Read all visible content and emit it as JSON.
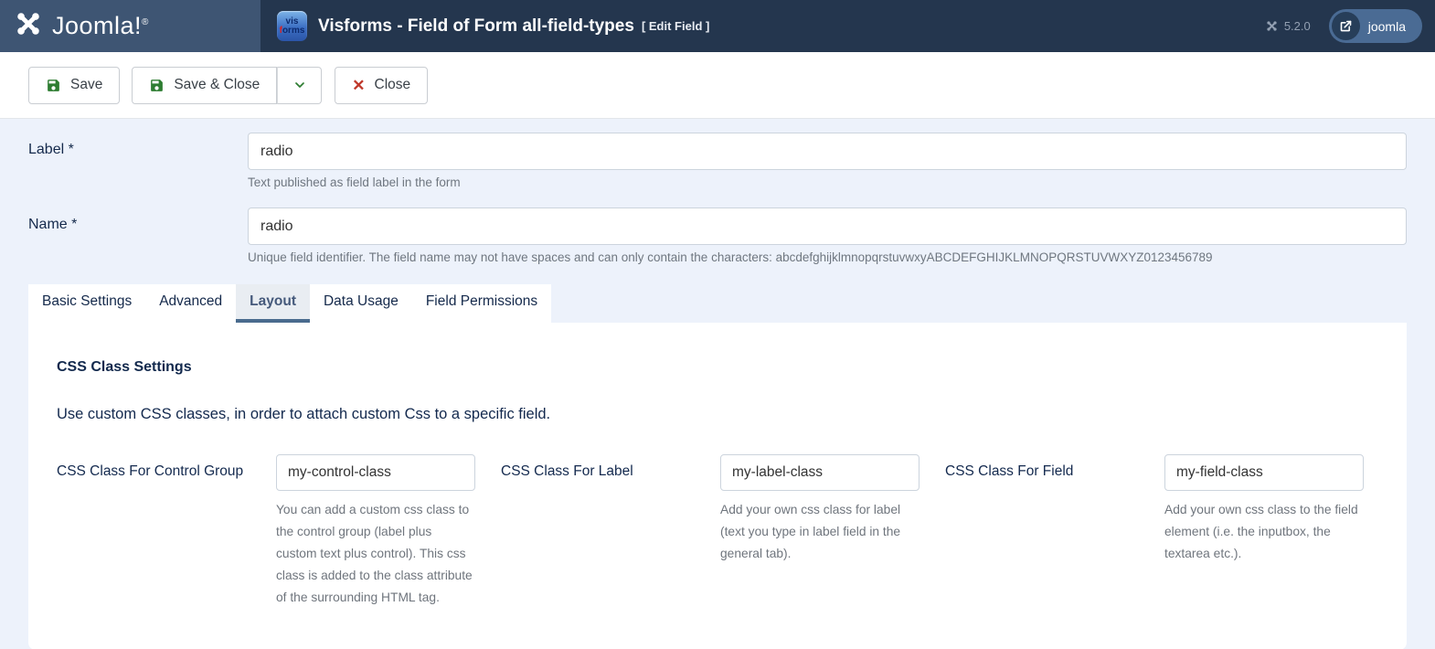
{
  "header": {
    "logo_text": "Joomla!",
    "logo_reg": "®",
    "app_icon": {
      "line1": "vis",
      "line2_f": "f",
      "line2_rest": "orms"
    },
    "title": "Visforms - Field of Form all-field-types",
    "title_suffix": "[ Edit Field ]",
    "version": "5.2.0",
    "user_button_label": "joomla"
  },
  "toolbar": {
    "save_label": "Save",
    "save_close_label": "Save & Close",
    "close_label": "Close",
    "close_icon_glyph": "✕"
  },
  "fields": {
    "label": {
      "label": "Label *",
      "value": "radio",
      "help": "Text published as field label in the form"
    },
    "name": {
      "label": "Name *",
      "value": "radio",
      "help": "Unique field identifier. The field name may not have spaces and can only contain the characters: abcdefghijklmnopqrstuvwxyABCDEFGHIJKLMNOPQRSTUVWXYZ0123456789"
    }
  },
  "tabs": [
    {
      "label": "Basic Settings",
      "active": false
    },
    {
      "label": "Advanced",
      "active": false
    },
    {
      "label": "Layout",
      "active": true
    },
    {
      "label": "Data Usage",
      "active": false
    },
    {
      "label": "Field Permissions",
      "active": false
    }
  ],
  "panel": {
    "section_title": "CSS Class Settings",
    "section_desc": "Use custom CSS classes, in order to attach custom Css to a specific field.",
    "controls": [
      {
        "label": "CSS Class For Control Group",
        "value": "my-control-class",
        "desc": "You can add a custom css class to the control group (label plus custom text plus control). This css class is added to the class attribute of the surrounding HTML tag."
      },
      {
        "label": "CSS Class For Label",
        "value": "my-label-class",
        "desc": "Add your own css class for label (text you type in label field in the general tab)."
      },
      {
        "label": "CSS Class For Field",
        "value": "my-field-class",
        "desc": "Add your own css class to the field element (i.e. the inputbox, the textarea etc.)."
      }
    ]
  },
  "colors": {
    "header_left_bg": "#3e5573",
    "header_right_bg": "#24364e",
    "body_bg": "#edf2fb",
    "accent_tab": "#4a6b8e",
    "save_icon_green": "#2e7d32",
    "close_icon_red": "#c0392b",
    "label_navy": "#13294e",
    "help_gray": "#6f7780"
  }
}
